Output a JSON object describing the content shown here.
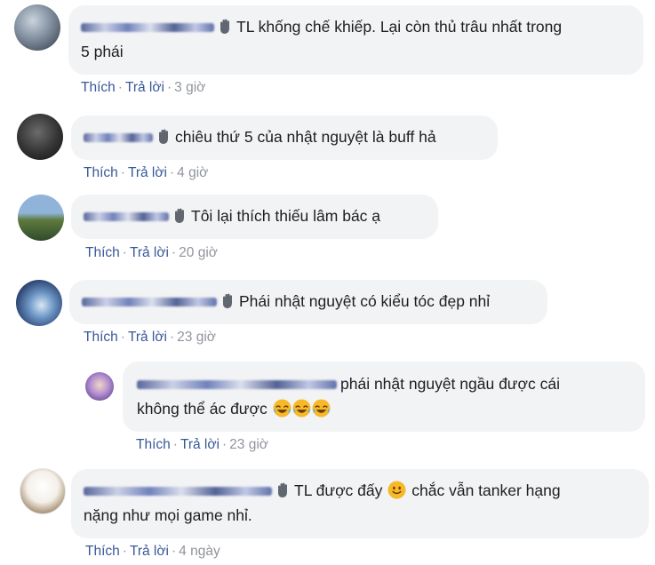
{
  "comments": [
    {
      "text_line1": "TL khống chế khiếp. Lại còn thủ trâu nhất trong",
      "text_line2": "5 phái",
      "like": "Thích",
      "reply": "Trả lời",
      "sep": "·",
      "time": "3 giờ"
    },
    {
      "text_line1": "chiêu thứ 5 của nhật nguyệt là buff hả",
      "like": "Thích",
      "reply": "Trả lời",
      "sep": "·",
      "time": "4 giờ"
    },
    {
      "text_line1": "Tôi lại thích thiếu lâm bác ạ",
      "like": "Thích",
      "reply": "Trả lời",
      "sep": "·",
      "time": "20 giờ"
    },
    {
      "text_line1": "Phái nhật nguyệt có kiểu tóc đẹp nhỉ",
      "like": "Thích",
      "reply": "Trả lời",
      "sep": "·",
      "time": "23 giờ"
    },
    {
      "text_line1": "phái nhật nguyệt ngầu được cái",
      "text_line2": "không thể ác được",
      "like": "Thích",
      "reply": "Trả lời",
      "sep": "·",
      "time": "23 giờ"
    },
    {
      "text_line1_a": "TL được đấy",
      "text_line1_b": "chắc vẫn tanker hạng",
      "text_line2": "nặng như mọi game nhỉ.",
      "like": "Thích",
      "reply": "Trả lời",
      "sep": "·",
      "time": "4 ngày"
    }
  ],
  "colors": {
    "bubble": "#f2f3f5",
    "link": "#385898",
    "meta": "#90949c",
    "text": "#1c1e21"
  }
}
